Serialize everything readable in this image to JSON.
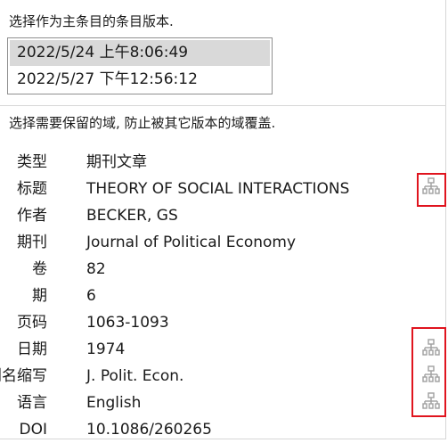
{
  "instructions": {
    "choose_version": "选择作为主条目的条目版本.",
    "choose_fields": "选择需要保留的域, 防止被其它版本的域覆盖."
  },
  "versions": [
    {
      "label": "2022/5/24 上午8:06:49",
      "selected": true
    },
    {
      "label": "2022/5/27 下午12:56:12",
      "selected": false
    }
  ],
  "fields": [
    {
      "label": "类型",
      "value": "期刊文章",
      "has_merge_icon": false
    },
    {
      "label": "标题",
      "value": "THEORY OF SOCIAL INTERACTIONS",
      "has_merge_icon": true
    },
    {
      "label": "作者",
      "value": "BECKER, GS",
      "has_merge_icon": false
    },
    {
      "label": "期刊",
      "value": "Journal of Political Economy",
      "has_merge_icon": false
    },
    {
      "label": "卷",
      "value": "82",
      "has_merge_icon": false
    },
    {
      "label": "期",
      "value": "6",
      "has_merge_icon": false
    },
    {
      "label": "页码",
      "value": "1063-1093",
      "has_merge_icon": false
    },
    {
      "label": "日期",
      "value": "1974",
      "has_merge_icon": true
    },
    {
      "label": "刊名缩写",
      "value": "J. Polit. Econ.",
      "has_merge_icon": true
    },
    {
      "label": "语言",
      "value": "English",
      "has_merge_icon": true
    },
    {
      "label": "DOI",
      "value": "10.1086/260265",
      "has_merge_icon": false
    }
  ],
  "icons": {
    "field_version_button": "field-version-selector-icon"
  },
  "colors": {
    "highlight": "#e0141e",
    "selected_row": "#d9d9d9",
    "icon": "#a0a0a0"
  }
}
